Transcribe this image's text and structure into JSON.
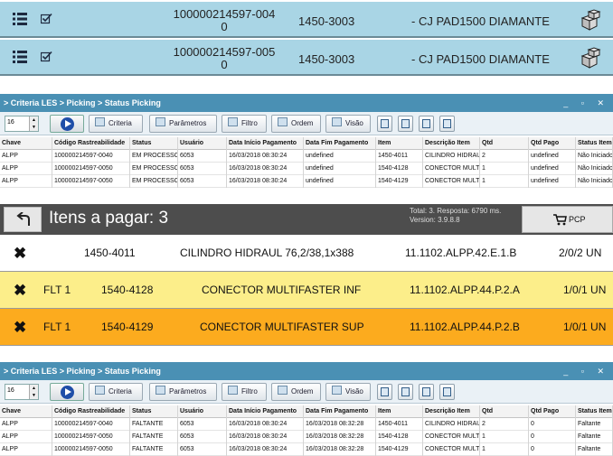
{
  "top_rows": [
    {
      "code_line1": "100000214597-004",
      "code_line2": "0",
      "ref": "1450-3003",
      "desc": "- CJ PAD1500 DIAMANTE"
    },
    {
      "code_line1": "100000214597-005",
      "code_line2": "0",
      "ref": "1450-3003",
      "desc": "- CJ PAD1500 DIAMANTE"
    }
  ],
  "panel_top": {
    "title": "> Criteria LES > Picking > Status Picking",
    "window_controls": "_ ▫ ✕",
    "page_size": "16",
    "buttons": {
      "criteria": "Criteria",
      "parametros": "Parâmetros",
      "filtro": "Filtro",
      "ordem": "Ordem",
      "visao": "Visão"
    },
    "columns": [
      "Chave",
      "Código Rastreabilidade",
      "Status",
      "Usuário",
      "Data Início Pagamento",
      "Data Fim Pagamento",
      "Item",
      "Descrição Item",
      "Qtd",
      "Qtd Pago",
      "Status Item"
    ],
    "rows": [
      [
        "ALPP",
        "100000214597-0040",
        "EM PROCESSO",
        "6053",
        "16/03/2018 08:30:24",
        "undefined",
        "1450-4011",
        "CILINDRO HIDRAUL",
        "2",
        "undefined",
        "Não Iniciado"
      ],
      [
        "ALPP",
        "100000214597-0050",
        "EM PROCESSO",
        "6053",
        "16/03/2018 08:30:24",
        "undefined",
        "1540-4128",
        "CONECTOR MULTI",
        "1",
        "undefined",
        "Não Iniciado"
      ],
      [
        "ALPP",
        "100000214597-0050",
        "EM PROCESSO",
        "6053",
        "16/03/2018 08:30:24",
        "undefined",
        "1540-4129",
        "CONECTOR MULTI",
        "1",
        "undefined",
        "Não Iniciado"
      ]
    ]
  },
  "picking_bar": {
    "title": "Itens a pagar: 3",
    "total_line": "Total: 3. Resposta: 6790 ms.",
    "version_line": "Version: 3.9.8.8",
    "pcp_label": "PCP"
  },
  "items": [
    {
      "flt": "",
      "ref": "1450-4011",
      "desc": "CILINDRO HIDRAUL 76,2/38,1x388",
      "loc": "11.1102.ALPP.42.E.1.B",
      "qty": "2/0/2 UN",
      "bg": "#ffffff"
    },
    {
      "flt": "FLT 1",
      "ref": "1540-4128",
      "desc": "CONECTOR MULTIFASTER INF",
      "loc": "11.1102.ALPP.44.P.2.A",
      "qty": "1/0/1 UN",
      "bg": "#fcee8a"
    },
    {
      "flt": "FLT 1",
      "ref": "1540-4129",
      "desc": "CONECTOR MULTIFASTER SUP",
      "loc": "11.1102.ALPP.44.P.2.B",
      "qty": "1/0/1 UN",
      "bg": "#fcab1e"
    }
  ],
  "panel_bottom": {
    "title": "> Criteria LES > Picking > Status Picking",
    "window_controls": "_ ▫ ✕",
    "page_size": "16",
    "buttons": {
      "criteria": "Criteria",
      "parametros": "Parâmetros",
      "filtro": "Filtro",
      "ordem": "Ordem",
      "visao": "Visão"
    },
    "columns": [
      "Chave",
      "Código Rastreabilidade",
      "Status",
      "Usuário",
      "Data Início Pagamento",
      "Data Fim Pagamento",
      "Item",
      "Descrição Item",
      "Qtd",
      "Qtd Pago",
      "Status Item"
    ],
    "rows": [
      [
        "ALPP",
        "100000214597-0040",
        "FALTANTE",
        "6053",
        "16/03/2018 08:30:24",
        "16/03/2018 08:32:28",
        "1450-4011",
        "CILINDRO HIDRAUL",
        "2",
        "0",
        "Faltante"
      ],
      [
        "ALPP",
        "100000214597-0050",
        "FALTANTE",
        "6053",
        "16/03/2018 08:30:24",
        "16/03/2018 08:32:28",
        "1540-4128",
        "CONECTOR MULTI",
        "1",
        "0",
        "Faltante"
      ],
      [
        "ALPP",
        "100000214597-0050",
        "FALTANTE",
        "6053",
        "16/03/2018 08:30:24",
        "16/03/2018 08:32:28",
        "1540-4129",
        "CONECTOR MULTI",
        "1",
        "0",
        "Faltante"
      ]
    ]
  }
}
